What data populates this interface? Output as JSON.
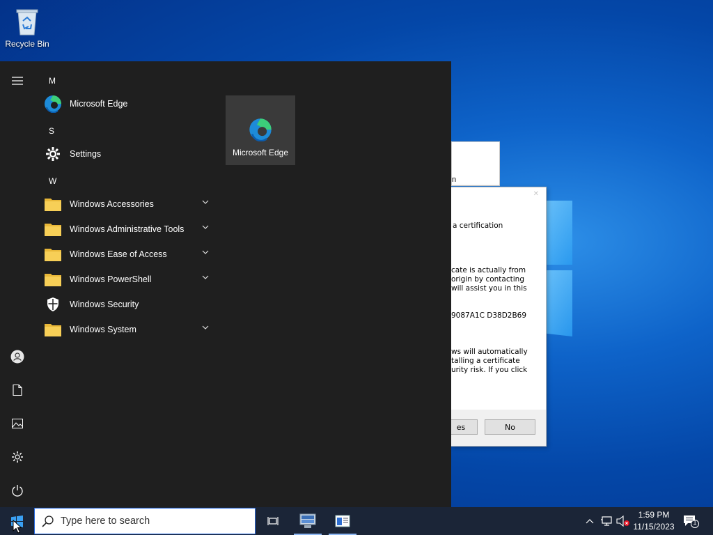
{
  "desktop": {
    "recycle_bin_label": "Recycle Bin"
  },
  "background_dialog": {
    "fragment": "n"
  },
  "security_dialog": {
    "lines": [
      "a certification",
      "cate is actually from",
      "origin by contacting",
      "will assist you in this",
      "9087A1C D38D2B69",
      "ws will automatically",
      "talling a certificate",
      "urity risk. If you click"
    ],
    "yes_label": "es",
    "no_label": "No"
  },
  "start_menu": {
    "groups": [
      {
        "letter": "M",
        "apps": [
          {
            "name": "Microsoft Edge",
            "icon": "edge-icon",
            "expandable": false
          }
        ]
      },
      {
        "letter": "S",
        "apps": [
          {
            "name": "Settings",
            "icon": "gear-icon",
            "expandable": false
          }
        ]
      },
      {
        "letter": "W",
        "apps": [
          {
            "name": "Windows Accessories",
            "icon": "folder-icon",
            "expandable": true
          },
          {
            "name": "Windows Administrative Tools",
            "icon": "folder-icon",
            "expandable": true
          },
          {
            "name": "Windows Ease of Access",
            "icon": "folder-icon",
            "expandable": true
          },
          {
            "name": "Windows PowerShell",
            "icon": "folder-icon",
            "expandable": true
          },
          {
            "name": "Windows Security",
            "icon": "shield-icon",
            "expandable": false
          },
          {
            "name": "Windows System",
            "icon": "folder-icon",
            "expandable": true
          }
        ]
      }
    ],
    "tile": {
      "name": "Microsoft Edge",
      "icon": "edge-icon"
    },
    "rail": [
      "hamburger-icon",
      "user-icon",
      "document-icon",
      "pictures-icon",
      "settings-icon",
      "power-icon"
    ]
  },
  "taskbar": {
    "search_placeholder": "Type here to search",
    "time": "1:59 PM",
    "date": "11/15/2023",
    "notification_count": "1"
  },
  "colors": {
    "start_menu_bg": "#1f1f1f",
    "taskbar_bg": "#1b2537",
    "tile_bg": "#3a3a3a",
    "accent": "#0078d7"
  }
}
